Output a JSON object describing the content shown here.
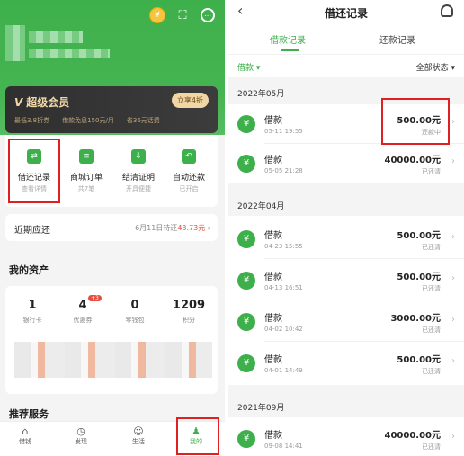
{
  "left": {
    "vip": {
      "title": "超级会员",
      "button": "立享4折",
      "perks": [
        "最低3.8折券",
        "借款免息150元/月",
        "省36元话费"
      ]
    },
    "quick": [
      {
        "label": "借还记录",
        "sub": "查看详情",
        "icon": "⇄"
      },
      {
        "label": "商城订单",
        "sub": "共7笔",
        "icon": "≡"
      },
      {
        "label": "结清证明",
        "sub": "开具便捷",
        "icon": "⇩"
      },
      {
        "label": "自动还款",
        "sub": "已开启",
        "icon": "↶"
      }
    ],
    "due": {
      "label": "近期应还",
      "date_text": "6月11日待还",
      "amount": "43.73元"
    },
    "assets_title": "我的资产",
    "assets": [
      {
        "value": "1",
        "label": "银行卡"
      },
      {
        "value": "4",
        "label": "优惠券",
        "badge": "+3"
      },
      {
        "value": "0",
        "label": "零钱包"
      },
      {
        "value": "1209",
        "label": "积分"
      }
    ],
    "recommend_title": "推荐服务",
    "tabs": [
      {
        "label": "借钱",
        "icon": "⌂"
      },
      {
        "label": "发现",
        "icon": "◷"
      },
      {
        "label": "生活",
        "icon": "☺"
      },
      {
        "label": "我的",
        "icon": "♟"
      }
    ]
  },
  "right": {
    "title": "借还记录",
    "tabs": [
      "借款记录",
      "还款记录"
    ],
    "filter_left": "借款 ▾",
    "filter_right": "全部状态 ▾",
    "groups": [
      {
        "month": "2022年05月",
        "rows": [
          {
            "name": "借款",
            "date": "05-11 19:55",
            "amount": "500.00元",
            "status": "还款中"
          },
          {
            "name": "借款",
            "date": "05-05 21:28",
            "amount": "40000.00元",
            "status": "已还清"
          }
        ]
      },
      {
        "month": "2022年04月",
        "rows": [
          {
            "name": "借款",
            "date": "04-23 15:55",
            "amount": "500.00元",
            "status": "已还清"
          },
          {
            "name": "借款",
            "date": "04-13 16:51",
            "amount": "500.00元",
            "status": "已还清"
          },
          {
            "name": "借款",
            "date": "04-02 10:42",
            "amount": "3000.00元",
            "status": "已还清"
          },
          {
            "name": "借款",
            "date": "04-01 14:49",
            "amount": "500.00元",
            "status": "已还清"
          }
        ]
      },
      {
        "month": "2021年09月",
        "rows": [
          {
            "name": "借款",
            "date": "09-08 14:41",
            "amount": "40000.00元",
            "status": "已还清"
          }
        ]
      }
    ]
  }
}
